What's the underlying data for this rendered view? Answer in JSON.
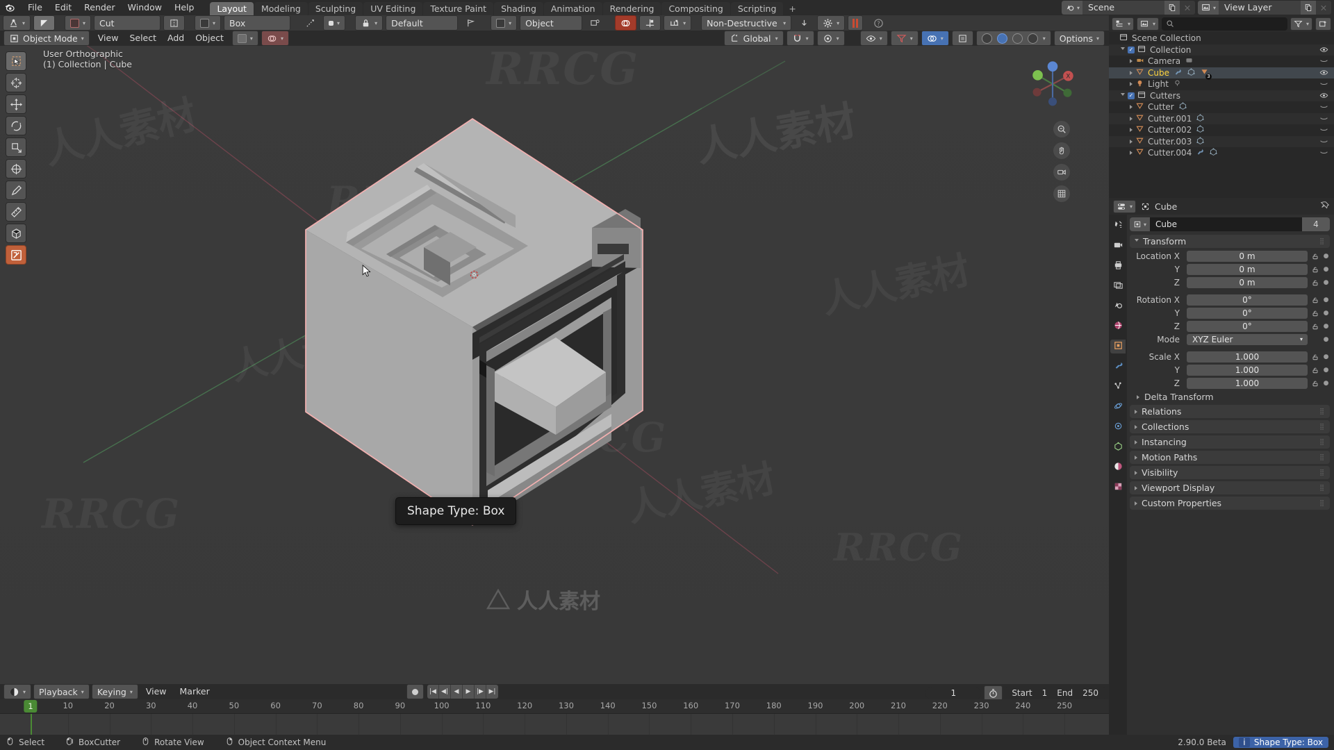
{
  "app": {
    "version": "2.90.0 Beta",
    "logo": "blender-logo-icon"
  },
  "topbar": {
    "menus": [
      "File",
      "Edit",
      "Render",
      "Window",
      "Help"
    ],
    "workspace_tabs": [
      {
        "label": "Layout",
        "active": true
      },
      {
        "label": "Modeling",
        "active": false
      },
      {
        "label": "Sculpting",
        "active": false
      },
      {
        "label": "UV Editing",
        "active": false
      },
      {
        "label": "Texture Paint",
        "active": false
      },
      {
        "label": "Shading",
        "active": false
      },
      {
        "label": "Animation",
        "active": false
      },
      {
        "label": "Rendering",
        "active": false
      },
      {
        "label": "Compositing",
        "active": false
      },
      {
        "label": "Scripting",
        "active": false
      }
    ],
    "add_workspace": "+",
    "scene": {
      "label": "Scene",
      "icon": "scene-icon",
      "new_icon": "duplicate-icon",
      "unlink_icon": "x-icon"
    },
    "view_layer": {
      "label": "View Layer",
      "icon": "view-layer-icon",
      "new_icon": "duplicate-icon",
      "unlink_icon": "x-icon"
    }
  },
  "boxcutter_header": {
    "mode_icon": "boxcutter-mode-icon",
    "toggle_icon": "cursor-arrow-icon",
    "operation_swatch": "operation-icon",
    "operation": "Cut",
    "mirror_icon": "mirror-icon",
    "shape_swatch": "shape-icon",
    "shape": "Box",
    "path_icon": "path-icon",
    "origin_swatch": "origin-icon",
    "lock_icon": "lock-icon",
    "preset": "Default",
    "flag_icon": "flag-icon",
    "axis_swatch": "axis-icon",
    "axis": "Object",
    "surface_icon": "surface-icon",
    "live_icon": "live-boolean-icon",
    "snap_icon": "snap-icon",
    "array_icon": "array-icon",
    "mode": "Non-Destructive",
    "down_icon": "arrow-down-icon",
    "gear_icon": "gear-icon",
    "pause_icon": "pause-icon",
    "help_icon": "question-icon"
  },
  "viewport_header": {
    "mode_icon": "object-mode-icon",
    "mode": "Object Mode",
    "menus": [
      "View",
      "Select",
      "Add",
      "Object"
    ],
    "snap_magnet_icon": "magnet-icon",
    "proportional_icon": "proportional-edit-icon",
    "transform_orientation_icon": "orientation-icon",
    "transform_orientation": "Global",
    "snap_icon": "snap-magnet-icon",
    "prop_icon": "proportional-icon",
    "visibility_icon": "visibility-eye-icon",
    "filter_icon": "filter-funnel-icon",
    "overlay_icon": "overlays-icon",
    "xray_icon": "xray-icon",
    "shading_modes": [
      "wireframe",
      "solid",
      "material-preview",
      "rendered"
    ],
    "shading_active_index": 1,
    "options_label": "Options"
  },
  "viewport": {
    "view_name": "User Orthographic",
    "active_object": "(1) Collection | Cube",
    "tooltip": "Shape Type: Box",
    "cursor_3d_icon": "3d-cursor-icon",
    "mouse_cursor_icon": "mouse-pointer-icon",
    "gizmo": {
      "axes": [
        {
          "label": "X",
          "color": "#d35b5b"
        },
        {
          "label": "Y",
          "color": "#7dc14f"
        },
        {
          "label": "Z",
          "color": "#5b87d3"
        }
      ]
    },
    "nav_buttons": [
      "zoom-icon",
      "pan-hand-icon",
      "camera-icon",
      "grid-ortho-icon"
    ],
    "toolbar_tools": [
      {
        "name": "tweak-select-tool",
        "active": false,
        "selected": true
      },
      {
        "name": "cursor-tool",
        "active": false,
        "selected": false
      },
      {
        "name": "move-tool",
        "active": false,
        "selected": false
      },
      {
        "name": "rotate-tool",
        "active": false,
        "selected": false
      },
      {
        "name": "scale-tool",
        "active": false,
        "selected": false
      },
      {
        "name": "transform-tool",
        "active": false,
        "selected": false
      },
      {
        "name": "annotate-tool",
        "active": false,
        "selected": false
      },
      {
        "name": "measure-tool",
        "active": false,
        "selected": false
      },
      {
        "name": "add-cube-tool",
        "active": false,
        "selected": false
      },
      {
        "name": "boxcutter-tool",
        "active": true,
        "selected": false
      }
    ],
    "watermarks": [
      "RRCG",
      "人人素材"
    ]
  },
  "outliner": {
    "display_mode_icon": "outliner-display-icon",
    "filter_scene_icon": "view-layer-icon",
    "search_placeholder": "",
    "search_icon": "search-icon",
    "filter_icon": "filter-funnel-icon",
    "new_collection_icon": "new-collection-icon",
    "rows": [
      {
        "label": "Scene Collection",
        "icon": "collection-icon",
        "depth": 0,
        "type": "scene-collection",
        "expander": "none",
        "checkbox": false,
        "visible_icon": "none",
        "active": false
      },
      {
        "label": "Collection",
        "icon": "collection-icon",
        "depth": 1,
        "type": "collection",
        "expander": "open",
        "checkbox": true,
        "visible_icon": "eye",
        "active": false
      },
      {
        "label": "Camera",
        "icon": "camera-obj-icon",
        "depth": 2,
        "type": "object",
        "expander": "closed",
        "checkbox": false,
        "visible_icon": "eye-closed",
        "active": false,
        "data_icons": [
          "camera-data-icon"
        ]
      },
      {
        "label": "Cube",
        "icon": "mesh-obj-icon",
        "depth": 2,
        "type": "object",
        "expander": "closed",
        "checkbox": false,
        "visible_icon": "eye",
        "active": true,
        "selected": true,
        "data_icons": [
          "modifier-wrench-icon",
          "mesh-data-icon",
          "child-count-icon"
        ],
        "child_count": "3"
      },
      {
        "label": "Light",
        "icon": "light-obj-icon",
        "depth": 2,
        "type": "object",
        "expander": "closed",
        "checkbox": false,
        "visible_icon": "eye-closed",
        "active": false,
        "data_icons": [
          "light-data-icon"
        ]
      },
      {
        "label": "Cutters",
        "icon": "collection-icon",
        "depth": 1,
        "type": "collection",
        "expander": "open",
        "checkbox": true,
        "visible_icon": "eye",
        "active": false
      },
      {
        "label": "Cutter",
        "icon": "mesh-obj-icon",
        "depth": 2,
        "type": "object",
        "expander": "closed",
        "checkbox": false,
        "visible_icon": "eye-closed",
        "active": false,
        "data_icons": [
          "mesh-data-icon"
        ]
      },
      {
        "label": "Cutter.001",
        "icon": "mesh-obj-icon",
        "depth": 2,
        "type": "object",
        "expander": "closed",
        "checkbox": false,
        "visible_icon": "eye-closed",
        "active": false,
        "data_icons": [
          "mesh-data-icon"
        ]
      },
      {
        "label": "Cutter.002",
        "icon": "mesh-obj-icon",
        "depth": 2,
        "type": "object",
        "expander": "closed",
        "checkbox": false,
        "visible_icon": "eye-closed",
        "active": false,
        "data_icons": [
          "mesh-data-icon"
        ]
      },
      {
        "label": "Cutter.003",
        "icon": "mesh-obj-icon",
        "depth": 2,
        "type": "object",
        "expander": "closed",
        "checkbox": false,
        "visible_icon": "eye-closed",
        "active": false,
        "data_icons": [
          "mesh-data-icon"
        ]
      },
      {
        "label": "Cutter.004",
        "icon": "mesh-obj-icon",
        "depth": 2,
        "type": "object",
        "expander": "closed",
        "checkbox": false,
        "visible_icon": "eye-closed",
        "active": false,
        "data_icons": [
          "modifier-wrench-icon",
          "mesh-data-icon"
        ]
      }
    ]
  },
  "properties": {
    "editor_icon": "properties-editor-icon",
    "breadcrumb_icon": "object-icon",
    "breadcrumb": "Cube",
    "pin_icon": "pin-icon",
    "tabs": [
      {
        "name": "tool-tab",
        "icon": "tool-icon",
        "active": false
      },
      {
        "name": "render-tab",
        "icon": "render-camera-icon",
        "active": false
      },
      {
        "name": "output-tab",
        "icon": "output-printer-icon",
        "active": false
      },
      {
        "name": "view-layer-tab",
        "icon": "view-layer-images-icon",
        "active": false
      },
      {
        "name": "scene-tab",
        "icon": "scene-cone-icon",
        "active": false
      },
      {
        "name": "world-tab",
        "icon": "world-globe-icon",
        "active": false
      },
      {
        "name": "object-tab",
        "icon": "object-square-icon",
        "active": true
      },
      {
        "name": "modifier-tab",
        "icon": "wrench-icon",
        "active": false
      },
      {
        "name": "particles-tab",
        "icon": "particles-icon",
        "active": false
      },
      {
        "name": "physics-tab",
        "icon": "physics-orbit-icon",
        "active": false
      },
      {
        "name": "constraints-tab",
        "icon": "constraint-icon",
        "active": false
      },
      {
        "name": "data-tab",
        "icon": "mesh-data-triangle-icon",
        "active": false
      },
      {
        "name": "material-tab",
        "icon": "material-sphere-icon",
        "active": false
      },
      {
        "name": "texture-tab",
        "icon": "texture-checker-icon",
        "active": false
      }
    ],
    "object_id": {
      "icon": "object-square-icon",
      "name": "Cube",
      "users": "4"
    },
    "transform_panel": {
      "title": "Transform",
      "open": true,
      "fields": [
        {
          "label": "Location X",
          "value": "0 m",
          "lock": "unlocked",
          "anim": "dot"
        },
        {
          "label": "Y",
          "value": "0 m",
          "lock": "unlocked",
          "anim": "dot"
        },
        {
          "label": "Z",
          "value": "0 m",
          "lock": "unlocked",
          "anim": "dot"
        },
        {
          "label": "Rotation X",
          "value": "0°",
          "lock": "unlocked",
          "anim": "dot"
        },
        {
          "label": "Y",
          "value": "0°",
          "lock": "unlocked",
          "anim": "dot"
        },
        {
          "label": "Z",
          "value": "0°",
          "lock": "unlocked",
          "anim": "dot"
        },
        {
          "label": "Mode",
          "value": "XYZ Euler",
          "type": "select",
          "anim": "dot"
        },
        {
          "label": "Scale X",
          "value": "1.000",
          "lock": "unlocked",
          "anim": "dot"
        },
        {
          "label": "Y",
          "value": "1.000",
          "lock": "unlocked",
          "anim": "dot"
        },
        {
          "label": "Z",
          "value": "1.000",
          "lock": "unlocked",
          "anim": "dot"
        }
      ],
      "subpanel": "Delta Transform"
    },
    "panels": [
      {
        "title": "Relations",
        "open": false
      },
      {
        "title": "Collections",
        "open": false
      },
      {
        "title": "Instancing",
        "open": false
      },
      {
        "title": "Motion Paths",
        "open": false
      },
      {
        "title": "Visibility",
        "open": false
      },
      {
        "title": "Viewport Display",
        "open": false
      },
      {
        "title": "Custom Properties",
        "open": false
      }
    ]
  },
  "timeline": {
    "editor_icon": "timeline-editor-icon",
    "menus": [
      {
        "label": "Playback",
        "dropdown": true
      },
      {
        "label": "Keying",
        "dropdown": true
      },
      {
        "label": "View",
        "dropdown": false
      },
      {
        "label": "Marker",
        "dropdown": false
      }
    ],
    "record_icon": "record-icon",
    "transport": [
      "jump-start-icon",
      "prev-keyframe-icon",
      "play-reverse-icon",
      "play-icon",
      "next-keyframe-icon",
      "jump-end-icon"
    ],
    "current_frame": "1",
    "auto_key_icon": "stopwatch-icon",
    "start_label": "Start",
    "start_value": "1",
    "end_label": "End",
    "end_value": "250",
    "ticks": [
      1,
      10,
      20,
      30,
      40,
      50,
      60,
      70,
      80,
      90,
      100,
      110,
      120,
      130,
      140,
      150,
      160,
      170,
      180,
      190,
      200,
      210,
      220,
      230,
      240,
      250
    ],
    "playhead_frame": 1,
    "range": [
      1,
      253
    ]
  },
  "statusbar": {
    "items": [
      {
        "icon": "mouse-left-icon",
        "label": "Select"
      },
      {
        "icon": "mouse-left-drag-icon",
        "label": "BoxCutter"
      },
      {
        "icon": "mouse-middle-icon",
        "label": "Rotate View"
      },
      {
        "icon": "mouse-right-icon",
        "label": "Object Context Menu"
      }
    ],
    "version": "2.90.0 Beta",
    "info_icon": "info-icon",
    "report": "Shape Type: Box"
  },
  "colors": {
    "accent": "#4772b3",
    "active_tool": "#c0603a",
    "selected_outline": "#ffa0a0",
    "axis_x": "#d35b5b",
    "axis_y": "#7dc14f",
    "axis_z": "#5b87d3",
    "playhead": "#4a8a34",
    "status_badge": "#3c63a8"
  }
}
